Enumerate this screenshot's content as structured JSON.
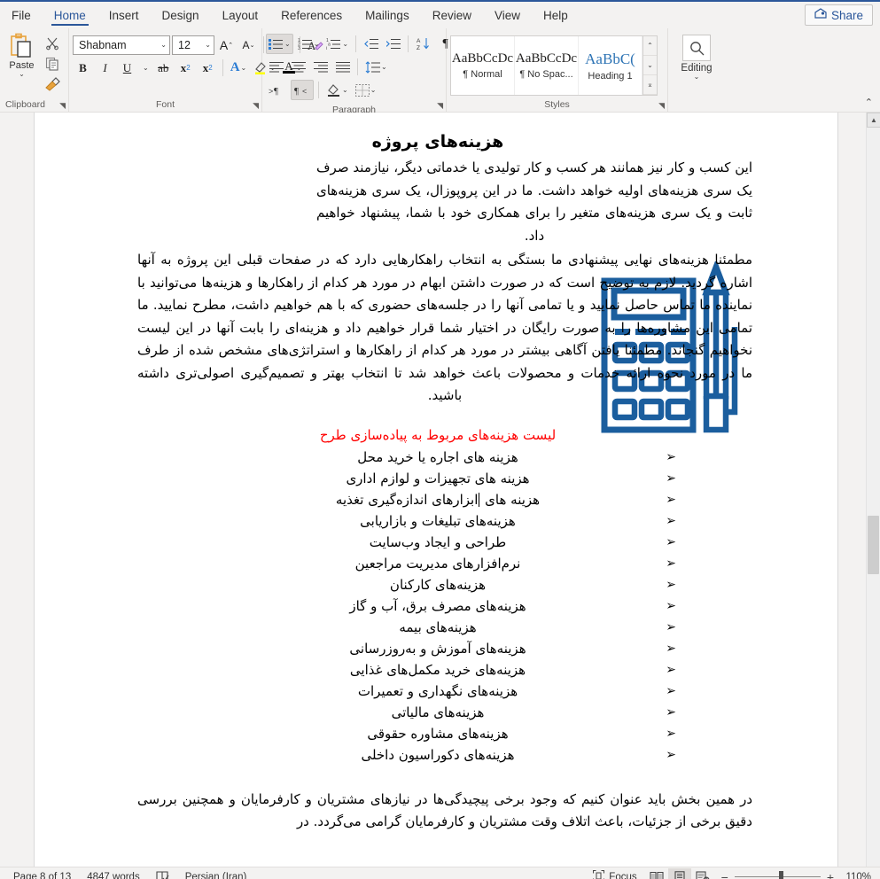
{
  "ribbon_tabs": [
    {
      "label": "File",
      "active": false
    },
    {
      "label": "Home",
      "active": true
    },
    {
      "label": "Insert",
      "active": false
    },
    {
      "label": "Design",
      "active": false
    },
    {
      "label": "Layout",
      "active": false
    },
    {
      "label": "References",
      "active": false
    },
    {
      "label": "Mailings",
      "active": false
    },
    {
      "label": "Review",
      "active": false
    },
    {
      "label": "View",
      "active": false
    },
    {
      "label": "Help",
      "active": false
    }
  ],
  "share": {
    "label": "Share",
    "icon": "share-person-icon"
  },
  "groups": {
    "clipboard": {
      "label": "Clipboard",
      "paste_label": "Paste",
      "cut_icon": "scissors-icon",
      "copy_icon": "copy-icon",
      "format_painter_icon": "format-painter-icon",
      "dialog_launcher": "dialog-launcher-icon"
    },
    "font": {
      "label": "Font",
      "font_name": "Shabnam",
      "font_size": "12",
      "grow_icon": "grow-font-icon",
      "shrink_icon": "shrink-font-icon",
      "change_case_label": "Aa",
      "clear_formatting_icon": "clear-formatting-icon",
      "bold_label": "B",
      "italic_label": "I",
      "underline_label": "U",
      "strikethrough_label": "ab",
      "subscript_label": "x",
      "superscript_label": "x",
      "text_effects_label": "A",
      "highlight_icon": "text-highlight-icon",
      "font_color_label": "A",
      "dialog_launcher": "dialog-launcher-icon"
    },
    "paragraph": {
      "label": "Paragraph",
      "bullets_icon": "bullet-list-icon",
      "numbering_icon": "numbered-list-icon",
      "multilevel_icon": "multilevel-list-icon",
      "align_left_icon": "align-left-icon",
      "align_center_icon": "align-center-icon",
      "align_right_icon": "align-right-icon",
      "justify_icon": "justify-icon",
      "line_spacing_icon": "line-spacing-icon",
      "ltr_icon": "left-to-right-icon",
      "rtl_icon": "right-to-left-icon",
      "shading_icon": "shading-icon",
      "borders_icon": "borders-icon",
      "decrease_indent_icon": "decrease-indent-icon",
      "increase_indent_icon": "increase-indent-icon",
      "sort_icon": "sort-icon",
      "show_marks_icon": "show-formatting-marks-icon",
      "dialog_launcher": "dialog-launcher-icon"
    },
    "styles": {
      "label": "Styles",
      "items": [
        {
          "preview": "AaBbCcDc",
          "name": "¶ Normal",
          "kind": "normal"
        },
        {
          "preview": "AaBbCcDc",
          "name": "¶ No Spac...",
          "kind": "nospace"
        },
        {
          "preview": "AaBbC(",
          "name": "Heading 1",
          "kind": "heading"
        }
      ],
      "scroll_up_icon": "scroll-up-icon",
      "scroll_down_icon": "scroll-down-icon",
      "more_styles_icon": "more-styles-icon",
      "dialog_launcher": "dialog-launcher-icon"
    },
    "editing": {
      "label": "Editing",
      "icon": "search-icon",
      "chevron": "chevron-down-icon"
    },
    "collapse_ribbon_icon": "collapse-ribbon-icon"
  },
  "document": {
    "title": "هزینه‌های پروژه",
    "paragraph1": "این کسب و کار نیز همانند هر کسب و کار تولیدی یا خدماتی دیگر، نیازمند صرف یک سری هزینه‌های اولیه خواهد داشت. ما در این پروپوزال، یک سری هزینه‌های ثابت و یک سری هزینه‌های متغیر را برای همکاری خود با شما، پیشنهاد خواهیم داد.",
    "paragraph2": "مطمئنا هزینه‌های نهایی پیشنهادی ما بستگی به انتخاب راهکارهایی دارد که در صفحات قبلی این پروژه به آنها اشاره گردید. لازم به توضیح است که در صورت داشتن ابهام در مورد هر کدام از راهکارها و هزینه‌ها می‌توانید با نماینده ما تماس حاصل نمایید و یا تمامی آنها را در جلسه‌های حضوری که با هم خواهیم داشت، مطرح نمایید. ما تمامی این مشاوره‌ها را به صورت رایگان در اختیار شما قرار خواهیم داد و هزینه‌ای را بابت آنها در این لیست نخواهیم گنجاند. مطمئنا یافتن آگاهی بیشتر در مورد هر کدام از راهکارها و استراتژی‌های مشخص شده از طرف ما در مورد نحوه ارائه خدمات و محصولات باعث خواهد شد تا انتخاب بهتر و تصمیم‌گیری اصولی‌تری داشته باشید.",
    "red_heading": "لیست هزینه‌های مربوط به پیاده‌سازی طرح",
    "red_heading_color": "#ff0000",
    "bullet_glyph": "➢",
    "bullets": [
      "هزینه های اجاره یا خرید محل",
      "هزینه های تجهیزات و لوازم اداری",
      "هزینه های ابزارهای اندازه‌گیری تغذیه",
      "هزینه‌های تبلیغات و بازاریابی",
      "طراحی و ایجاد وب‌سایت",
      "نرم‌افزارهای مدیریت مراجعین",
      "هزینه‌های کارکنان",
      "هزینه‌های مصرف برق، آب و گاز",
      "هزینه‌های بیمه",
      "هزینه‌های آموزش و به‌روزرسانی",
      "هزینه‌های خرید مکمل‌های غذایی",
      "هزینه‌های نگهداری و تعمیرات",
      "هزینه‌های مالیاتی",
      "هزینه‌های مشاوره حقوقی",
      "هزینه‌های دکوراسیون داخلی"
    ],
    "paragraph3": "در همین بخش باید عنوان کنیم که وجود برخی پیچیدگی‌ها در نیازهای مشتریان و کارفرمایان و همچنین بررسی دقیق برخی از جزئیات، باعث اتلاف وقت مشتریان و کارفرمایان گرامی می‌گردد. در",
    "illustration": "calculator-and-pencil-icon",
    "illustration_color": "#1b5e9e"
  },
  "statusbar": {
    "page": "Page 8 of 13",
    "words": "4847 words",
    "proofing_icon": "proofing-errors-icon",
    "language": "Persian (Iran)",
    "focus_label": "Focus",
    "focus_icon": "focus-mode-icon",
    "read_mode_icon": "read-mode-icon",
    "print_layout_icon": "print-layout-icon",
    "web_layout_icon": "web-layout-icon",
    "zoom_out": "−",
    "zoom_in": "+",
    "zoom_level": "110%"
  }
}
